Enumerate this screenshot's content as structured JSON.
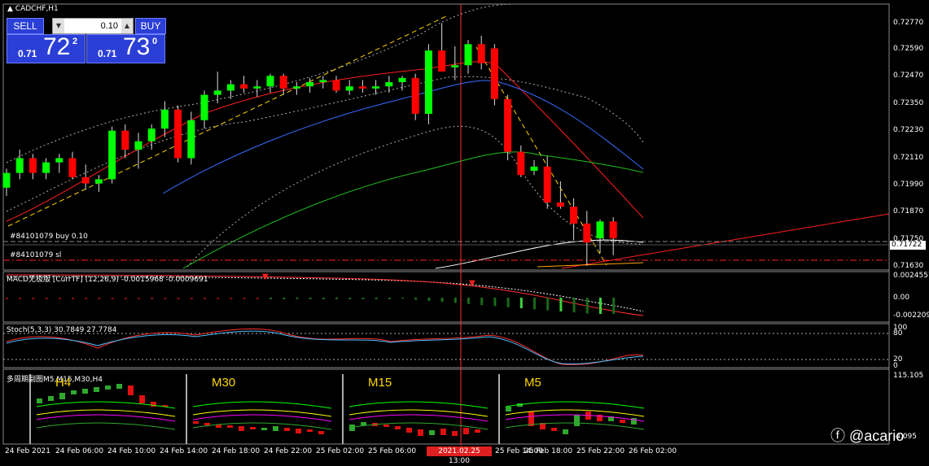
{
  "symbol_title": "CADCHF,H1",
  "trade_panel": {
    "sell_label": "SELL",
    "buy_label": "BUY",
    "lot_value": "0.10",
    "sell_price_small": "0.71",
    "sell_price_big": "72",
    "sell_price_sup": "2",
    "buy_price_small": "0.71",
    "buy_price_big": "73",
    "buy_price_sup": "0"
  },
  "order_labels": {
    "buy_order": "#84101079 buy 0.10",
    "sl_order": "#84101079 sl"
  },
  "indicators": {
    "macd_label": "MACD无极版 [CurrTF] (12,26,9) -0.0015968 -0.0009691",
    "stoch_label": "Stoch(5,3,3) 30.7849 27.7784",
    "multi_label": "多周期副图M5,M15,M30,H4"
  },
  "multi_tf": [
    "H4",
    "M30",
    "M15",
    "M5"
  ],
  "price_axis": [
    "0.72770",
    "0.72590",
    "0.72470",
    "0.72350",
    "0.72230",
    "0.72110",
    "0.71990",
    "0.71870",
    "0.71750",
    "0.71630"
  ],
  "current_price": "0.71722",
  "macd_axis": [
    "0.0024557",
    "0.00",
    "-0.002209"
  ],
  "stoch_axis": [
    "100",
    "80",
    "20",
    "0"
  ],
  "multi_axis": [
    "115.105",
    "-4.095"
  ],
  "time_axis": [
    "24 Feb 2021",
    "24 Feb 06:00",
    "24 Feb 10:00",
    "24 Feb 14:00",
    "24 Feb 18:00",
    "24 Feb 22:00",
    "25 Feb 02:00",
    "25 Feb 06:00",
    "25 Feb 14:00",
    "25 Feb 18:00",
    "25 Feb 22:00",
    "26 Feb 02:00"
  ],
  "crosshair_time": "2021.02.25 13:00",
  "watermark": "@acario",
  "colors": {
    "bull": "#00ff00",
    "bear": "#ff0000",
    "panel_blue": "#2b3fd6",
    "bg": "#000000"
  },
  "chart_data": {
    "type": "candlestick",
    "ylim": [
      0.7157,
      0.7283
    ],
    "candles": [
      [
        0.7196,
        0.7205,
        0.7192,
        0.7203
      ],
      [
        0.7203,
        0.7214,
        0.72,
        0.721
      ],
      [
        0.721,
        0.7212,
        0.72,
        0.7203
      ],
      [
        0.7203,
        0.721,
        0.72,
        0.7208
      ],
      [
        0.7208,
        0.7212,
        0.7203,
        0.721
      ],
      [
        0.721,
        0.7213,
        0.72,
        0.7201
      ],
      [
        0.7201,
        0.7207,
        0.7195,
        0.7198
      ],
      [
        0.7198,
        0.7202,
        0.7194,
        0.72
      ],
      [
        0.72,
        0.7225,
        0.7198,
        0.7223
      ],
      [
        0.7223,
        0.7226,
        0.721,
        0.7214
      ],
      [
        0.7214,
        0.7222,
        0.7205,
        0.7218
      ],
      [
        0.7218,
        0.7226,
        0.7214,
        0.7224
      ],
      [
        0.7224,
        0.7237,
        0.722,
        0.7233
      ],
      [
        0.7233,
        0.7235,
        0.7208,
        0.721
      ],
      [
        0.721,
        0.7232,
        0.7207,
        0.7228
      ],
      [
        0.7228,
        0.7242,
        0.7224,
        0.724
      ],
      [
        0.724,
        0.7251,
        0.7236,
        0.7242
      ],
      [
        0.7242,
        0.7247,
        0.7238,
        0.7245
      ],
      [
        0.7245,
        0.7249,
        0.7241,
        0.7243
      ],
      [
        0.7243,
        0.7247,
        0.7239,
        0.7244
      ],
      [
        0.7244,
        0.725,
        0.7241,
        0.7249
      ],
      [
        0.7249,
        0.725,
        0.724,
        0.7243
      ],
      [
        0.7243,
        0.7246,
        0.724,
        0.7244
      ],
      [
        0.7244,
        0.7248,
        0.7241,
        0.7246
      ],
      [
        0.7246,
        0.7249,
        0.7243,
        0.7247
      ],
      [
        0.7247,
        0.7249,
        0.7241,
        0.7242
      ],
      [
        0.7242,
        0.7247,
        0.724,
        0.7244
      ],
      [
        0.7244,
        0.7247,
        0.7241,
        0.7243
      ],
      [
        0.7243,
        0.7247,
        0.724,
        0.7244
      ],
      [
        0.7244,
        0.7249,
        0.7241,
        0.7246
      ],
      [
        0.7246,
        0.7249,
        0.7242,
        0.7248
      ],
      [
        0.7248,
        0.725,
        0.7228,
        0.7231
      ],
      [
        0.7231,
        0.7264,
        0.7226,
        0.7261
      ],
      [
        0.7261,
        0.7274,
        0.7252,
        0.7251
      ],
      [
        0.7253,
        0.7263,
        0.7247,
        0.7254
      ],
      [
        0.7254,
        0.7266,
        0.725,
        0.7264
      ],
      [
        0.7264,
        0.7268,
        0.7252,
        0.7255
      ],
      [
        0.7262,
        0.7264,
        0.7235,
        0.7238
      ],
      [
        0.7238,
        0.724,
        0.7209,
        0.7213
      ],
      [
        0.7213,
        0.7216,
        0.7201,
        0.7202
      ],
      [
        0.7204,
        0.7209,
        0.7202,
        0.7206
      ],
      [
        0.7206,
        0.7211,
        0.7186,
        0.7189
      ],
      [
        0.7189,
        0.7199,
        0.7186,
        0.7187
      ],
      [
        0.7187,
        0.7191,
        0.7171,
        0.7179
      ],
      [
        0.7179,
        0.7185,
        0.7159,
        0.717
      ],
      [
        0.7172,
        0.7181,
        0.7165,
        0.718
      ],
      [
        0.718,
        0.7182,
        0.7164,
        0.7172
      ]
    ]
  }
}
